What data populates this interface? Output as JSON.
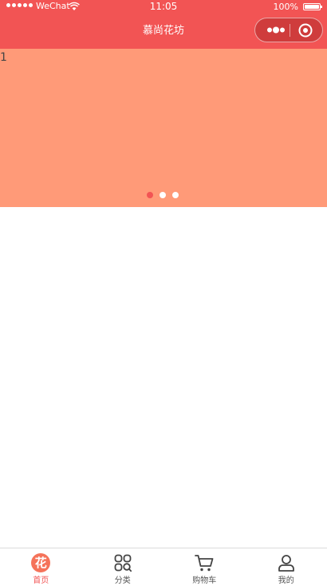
{
  "status_bar": {
    "carrier": "WeChat",
    "time": "11:05",
    "battery": "100%"
  },
  "nav": {
    "title": "慕尚花坊"
  },
  "banner": {
    "slide_label": "1",
    "slide_count": 3,
    "active_index": 0,
    "background_color": "#ff9a78"
  },
  "tabbar": {
    "active_color": "#f25454",
    "tabs": [
      {
        "label": "首页",
        "icon": "flower-logo-icon",
        "glyph": "花",
        "active": true
      },
      {
        "label": "分类",
        "icon": "category-icon",
        "active": false
      },
      {
        "label": "购物车",
        "icon": "cart-icon",
        "active": false
      },
      {
        "label": "我的",
        "icon": "user-icon",
        "active": false
      }
    ]
  },
  "colors": {
    "brand": "#f25454"
  }
}
